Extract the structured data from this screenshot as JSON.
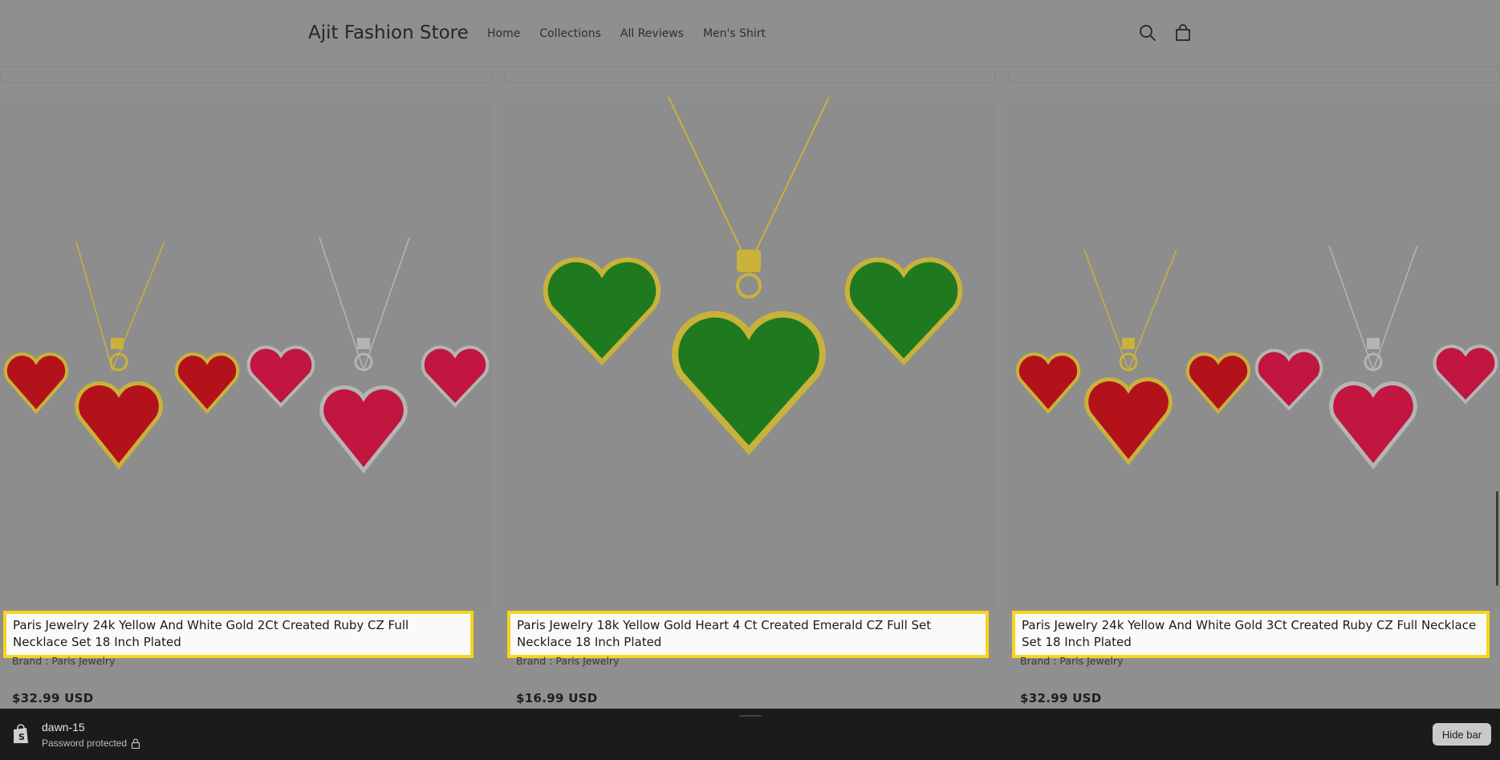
{
  "header": {
    "logo": "Ajit Fashion Store",
    "nav": [
      "Home",
      "Collections",
      "All Reviews",
      "Men's Shirt"
    ],
    "icons": [
      "search-icon",
      "cart-icon"
    ]
  },
  "products": [
    {
      "title": "Paris Jewelry 24k Yellow And White Gold 2Ct Created Ruby CZ Full Necklace Set 18 Inch Plated",
      "brand": "Brand : Paris Jewelry",
      "price": "$32.99 USD",
      "stone_color": "#b3121b"
    },
    {
      "title": "Paris Jewelry 18k Yellow Gold Heart 4 Ct Created Emerald CZ Full Set Necklace 18 Inch Plated",
      "brand": "Brand : Paris Jewelry",
      "price": "$16.99 USD",
      "stone_color": "#1f7a1f"
    },
    {
      "title": "Paris Jewelry 24k Yellow And White Gold 3Ct Created Ruby CZ Full Necklace Set 18 Inch Plated",
      "brand": "Brand : Paris Jewelry",
      "price": "$32.99 USD",
      "stone_color": "#b3121b"
    }
  ],
  "adminbar": {
    "theme": "dawn-15",
    "status": "Password protected",
    "hide_label": "Hide bar"
  },
  "colors": {
    "highlight": "#f7d51d",
    "gold": "#c9b23a",
    "silver": "#b5b5b5"
  }
}
